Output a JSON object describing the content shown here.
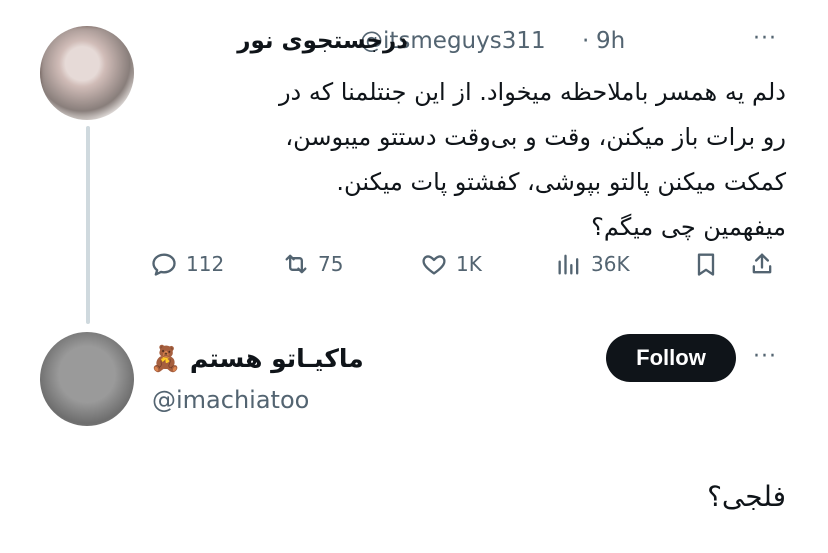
{
  "tweet": {
    "author_name": "درجستجوی نور",
    "author_handle": "@itsmeguys311",
    "separator": "·",
    "time": "9h",
    "more": "···",
    "lines": [
      "دلم یه همسر باملاحظه میخواد. از این جنتلمنا که در",
      "رو برات باز میکنن، وقت و بی‌وقت دستتو میبوسن،",
      "کمکت میکنن پالتو بپوشی، کفشتو پات میکنن.",
      "میفهمین چی میگم؟"
    ],
    "stats": {
      "replies": "112",
      "retweets": "75",
      "likes": "1K",
      "views": "36K"
    },
    "icons": [
      "reply-icon",
      "retweet-icon",
      "like-icon",
      "views-icon",
      "bookmark-icon",
      "share-icon"
    ]
  },
  "reply": {
    "author_name": "ماکیـاتو هستم 🧸",
    "author_handle": "@imachiatoo",
    "follow_label": "Follow",
    "more": "···",
    "text": "فلجی؟"
  },
  "colors": {
    "text": "#0f1419",
    "muted": "#536471",
    "button": "#0f1419",
    "thread_line": "#cfd9de"
  }
}
